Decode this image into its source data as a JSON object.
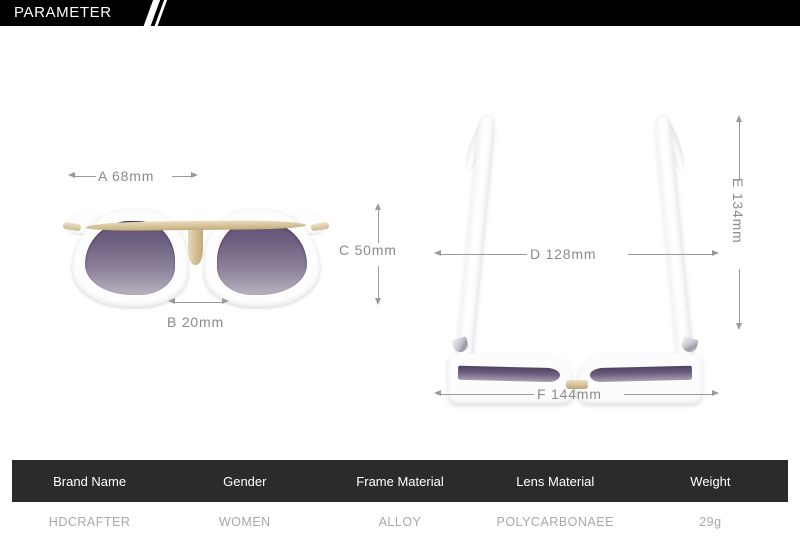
{
  "header": {
    "title": "PARAMETER"
  },
  "dimensions": {
    "a": "A 68mm",
    "b": "B 20mm",
    "c": "C 50mm",
    "d": "D 128mm",
    "e": "E 134mm",
    "f": "F 144mm"
  },
  "spec_table": {
    "headers": [
      "Brand Name",
      "Gender",
      "Frame Material",
      "Lens Material",
      "Weight"
    ],
    "rows": [
      [
        "HDCRAFTER",
        "WOMEN",
        "ALLOY",
        "POLYCARBONAEE",
        "29g"
      ]
    ]
  },
  "colors": {
    "header_bar": "#000000",
    "table_header": "#2b2b2b",
    "dimension_text": "#8b8b8b",
    "row_text": "#a8a8a8",
    "lens_top": "#5f5071",
    "lens_bottom": "#b7b0bf",
    "metal_gold": "#d4c096"
  }
}
